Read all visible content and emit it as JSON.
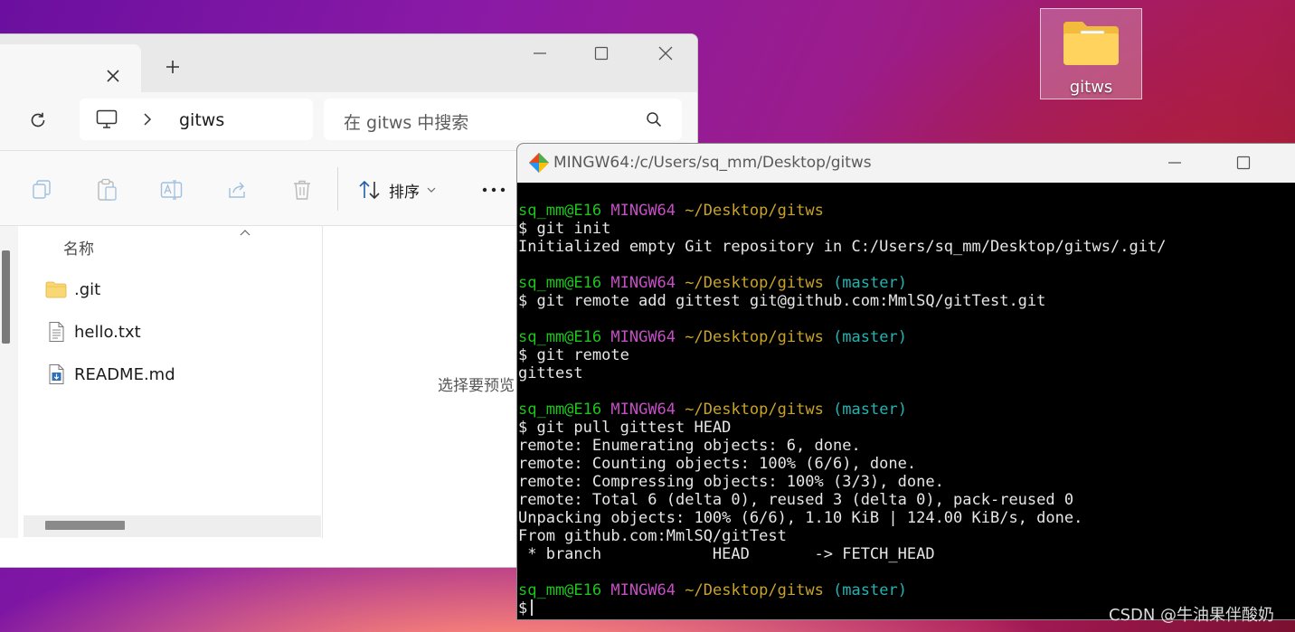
{
  "explorer": {
    "address_path": "gitws",
    "search_placeholder": "在 gitws 中搜索",
    "sort_label": "排序",
    "column_name": "名称",
    "files": [
      {
        "name": ".git",
        "icon": "folder-icon"
      },
      {
        "name": "hello.txt",
        "icon": "text-file-icon"
      },
      {
        "name": "README.md",
        "icon": "markdown-file-icon"
      }
    ],
    "preview_message": "选择要预览"
  },
  "desktop": {
    "icon_label": "gitws"
  },
  "terminal": {
    "title": "MINGW64:/c/Users/sq_mm/Desktop/gitws",
    "prompt_user": "sq_mm@E16",
    "prompt_system": "MINGW64",
    "prompt_path": "~/Desktop/gitws",
    "prompt_branch": "(master)",
    "blocks": [
      {
        "branch": false,
        "command": "$ git init",
        "output": [
          "Initialized empty Git repository in C:/Users/sq_mm/Desktop/gitws/.git/"
        ]
      },
      {
        "branch": true,
        "command": "$ git remote add gittest git@github.com:MmlSQ/gitTest.git",
        "output": []
      },
      {
        "branch": true,
        "command": "$ git remote",
        "output": [
          "gittest"
        ]
      },
      {
        "branch": true,
        "command": "$ git pull gittest HEAD",
        "output": [
          "remote: Enumerating objects: 6, done.",
          "remote: Counting objects: 100% (6/6), done.",
          "remote: Compressing objects: 100% (3/3), done.",
          "remote: Total 6 (delta 0), reused 3 (delta 0), pack-reused 0",
          "Unpacking objects: 100% (6/6), 1.10 KiB | 124.00 KiB/s, done.",
          "From github.com:MmlSQ/gitTest",
          " * branch            HEAD       -> FETCH_HEAD"
        ]
      },
      {
        "branch": true,
        "command": "$",
        "output": []
      }
    ]
  },
  "watermark": "CSDN @牛油果伴酸奶"
}
